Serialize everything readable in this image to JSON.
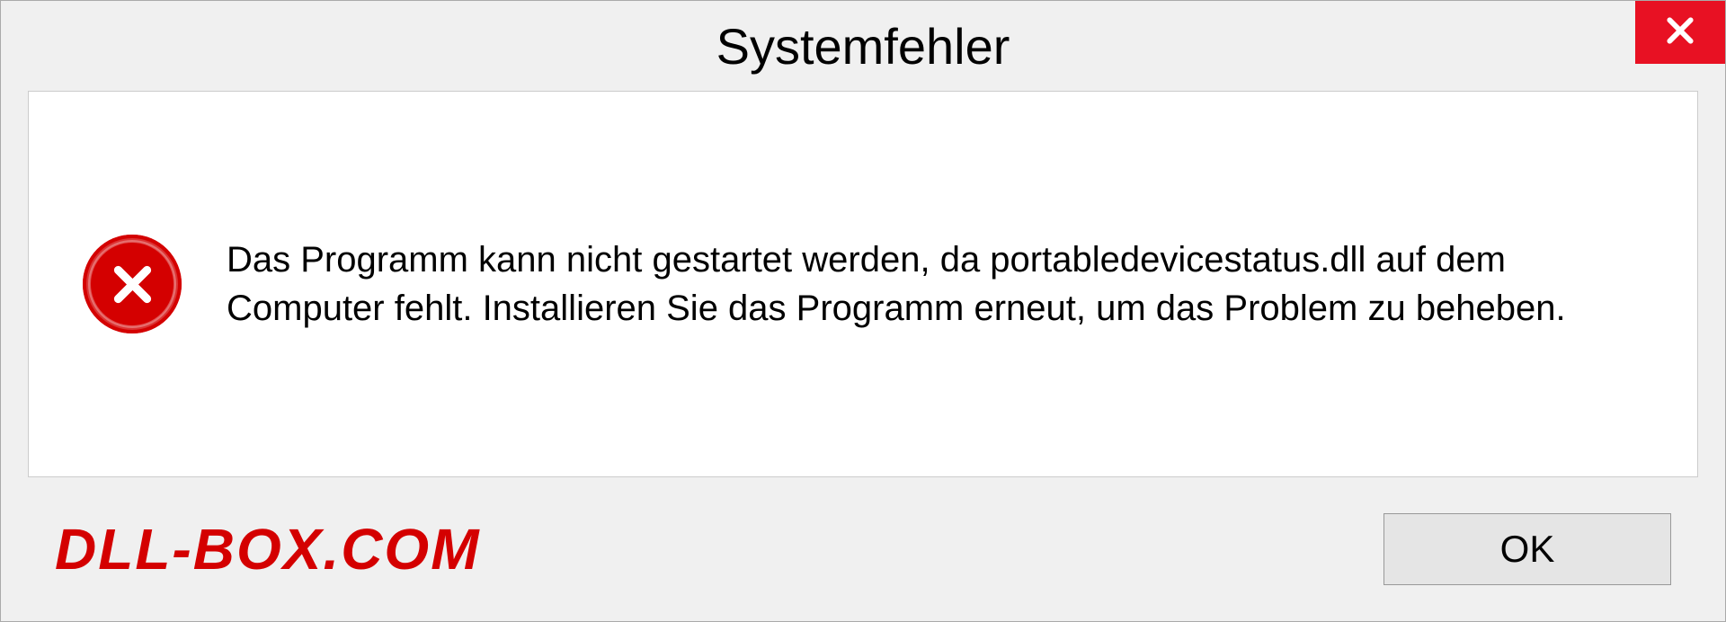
{
  "dialog": {
    "title": "Systemfehler",
    "message": "Das Programm kann nicht gestartet werden, da portabledevicestatus.dll auf dem Computer fehlt. Installieren Sie das Programm erneut, um das Problem zu beheben.",
    "ok_label": "OK"
  },
  "watermark": {
    "text": "DLL-BOX.COM"
  },
  "colors": {
    "close_button": "#e81123",
    "error_icon": "#d40000",
    "watermark": "#d40000"
  }
}
